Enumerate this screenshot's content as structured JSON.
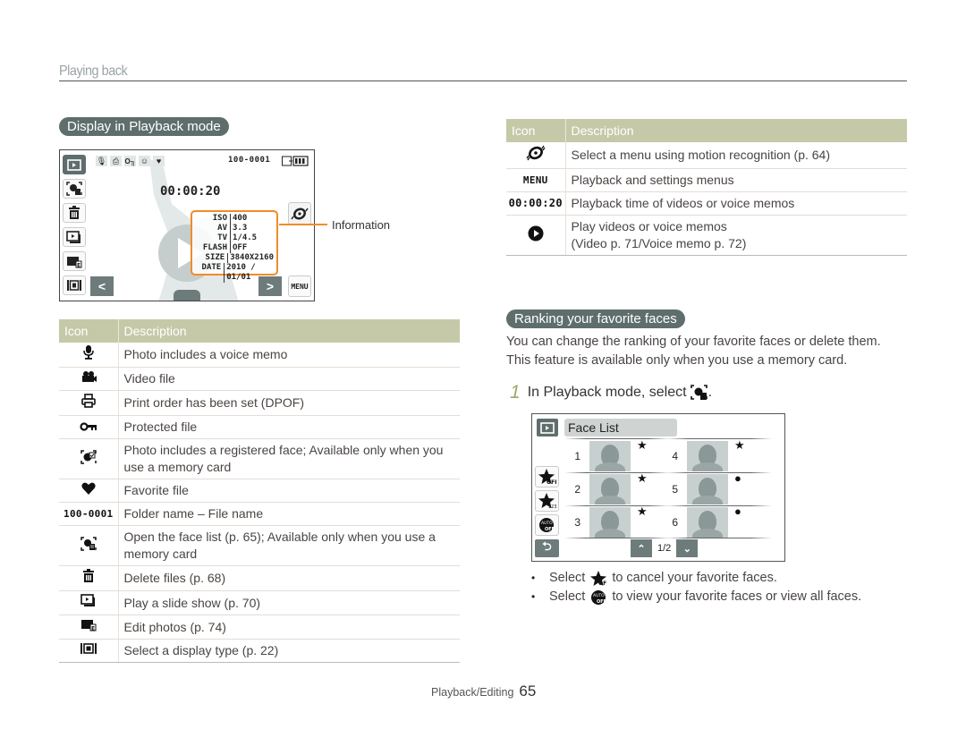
{
  "header": {
    "title": "Playing back"
  },
  "section1": {
    "title": "Display in Playback mode"
  },
  "camera_screen": {
    "file_number": "100-0001",
    "timer": "00:00:20",
    "top_icons": [
      "voice-memo-icon",
      "print-icon",
      "protect-key-icon",
      "registered-face-icon",
      "heart-icon"
    ],
    "info": [
      {
        "key": "ISO",
        "value": "400"
      },
      {
        "key": "AV",
        "value": "3.3"
      },
      {
        "key": "TV",
        "value": "1/4.5"
      },
      {
        "key": "FLASH",
        "value": "OFF"
      },
      {
        "key": "SIZE",
        "value": "3840X2160"
      },
      {
        "key": "DATE",
        "value": "2010 / 01/01"
      }
    ],
    "menu_label": "MENU",
    "prev_label": "<",
    "next_label": ">",
    "callout": "Information",
    "accent": "#f08c2a"
  },
  "table1": {
    "headers": {
      "icon": "Icon",
      "description": "Description"
    },
    "rows": [
      {
        "icon": "voice-memo-icon",
        "glyph": "🎙",
        "description": "Photo includes a voice memo"
      },
      {
        "icon": "video-camera-icon",
        "glyph": "🎥",
        "description": "Video file"
      },
      {
        "icon": "printer-icon",
        "glyph": "🖶",
        "description": "Print order has been set (DPOF)"
      },
      {
        "icon": "key-icon",
        "glyph": "O╖",
        "description": "Protected file"
      },
      {
        "icon": "registered-face-icon",
        "glyph": "☺",
        "description": "Photo includes a registered face; Available only when you use a memory card"
      },
      {
        "icon": "heart-icon",
        "glyph": "♥",
        "description": "Favorite file"
      },
      {
        "icon": "folder-file-number",
        "glyph": "100-0001",
        "description": "Folder name – File name"
      },
      {
        "icon": "face-list-icon",
        "glyph": "☻",
        "description": "Open the face list (p. 65); Available only when you use a memory card"
      },
      {
        "icon": "trash-icon",
        "glyph": "🗑",
        "description": "Delete files (p. 68)"
      },
      {
        "icon": "slideshow-icon",
        "glyph": "▶",
        "description": "Play a slide show (p. 70)"
      },
      {
        "icon": "edit-photo-icon",
        "glyph": "▬",
        "description": "Edit photos (p. 74)"
      },
      {
        "icon": "display-type-icon",
        "glyph": "|▣|",
        "description": "Select a display type (p. 22)"
      }
    ]
  },
  "table2": {
    "headers": {
      "icon": "Icon",
      "description": "Description"
    },
    "rows": [
      {
        "icon": "motion-recognition-icon",
        "glyph": "◎",
        "description": "Select a menu using motion recognition (p. 64)"
      },
      {
        "icon": "menu-label",
        "glyph": "MENU",
        "description": "Playback and settings menus"
      },
      {
        "icon": "timer-label",
        "glyph": "00:00:20",
        "description": "Playback time of videos or voice memos"
      },
      {
        "icon": "play-circle-icon",
        "glyph": "▶",
        "description": "Play videos or voice memos",
        "description2": "(Video p. 71/Voice memo p. 72)"
      }
    ]
  },
  "section2": {
    "title": "Ranking your favorite faces",
    "intro_line1": "You can change the ranking of your favorite faces or delete them.",
    "intro_line2": "This feature is available only when you use a memory card.",
    "step_number": "1",
    "step_text": "In Playback mode, select",
    "step_suffix": "."
  },
  "face_list": {
    "title": "Face List",
    "entries": [
      {
        "rank": "1",
        "mark": "★"
      },
      {
        "rank": "2",
        "mark": "★"
      },
      {
        "rank": "3",
        "mark": "★"
      },
      {
        "rank": "4",
        "mark": "★"
      },
      {
        "rank": "5",
        "mark": "●"
      },
      {
        "rank": "6",
        "mark": "●"
      }
    ],
    "page": "1/2",
    "side_buttons": [
      "favorite-off-icon",
      "favorite-rank-icon",
      "auto-off-icon"
    ]
  },
  "bullets": [
    {
      "before": "Select",
      "icon": "favorite-off-icon",
      "after": "to cancel your favorite faces."
    },
    {
      "before": "Select",
      "icon": "auto-off-icon",
      "after": "to view your favorite faces or view all faces."
    }
  ],
  "footer": {
    "section": "Playback/Editing",
    "page": "65"
  }
}
